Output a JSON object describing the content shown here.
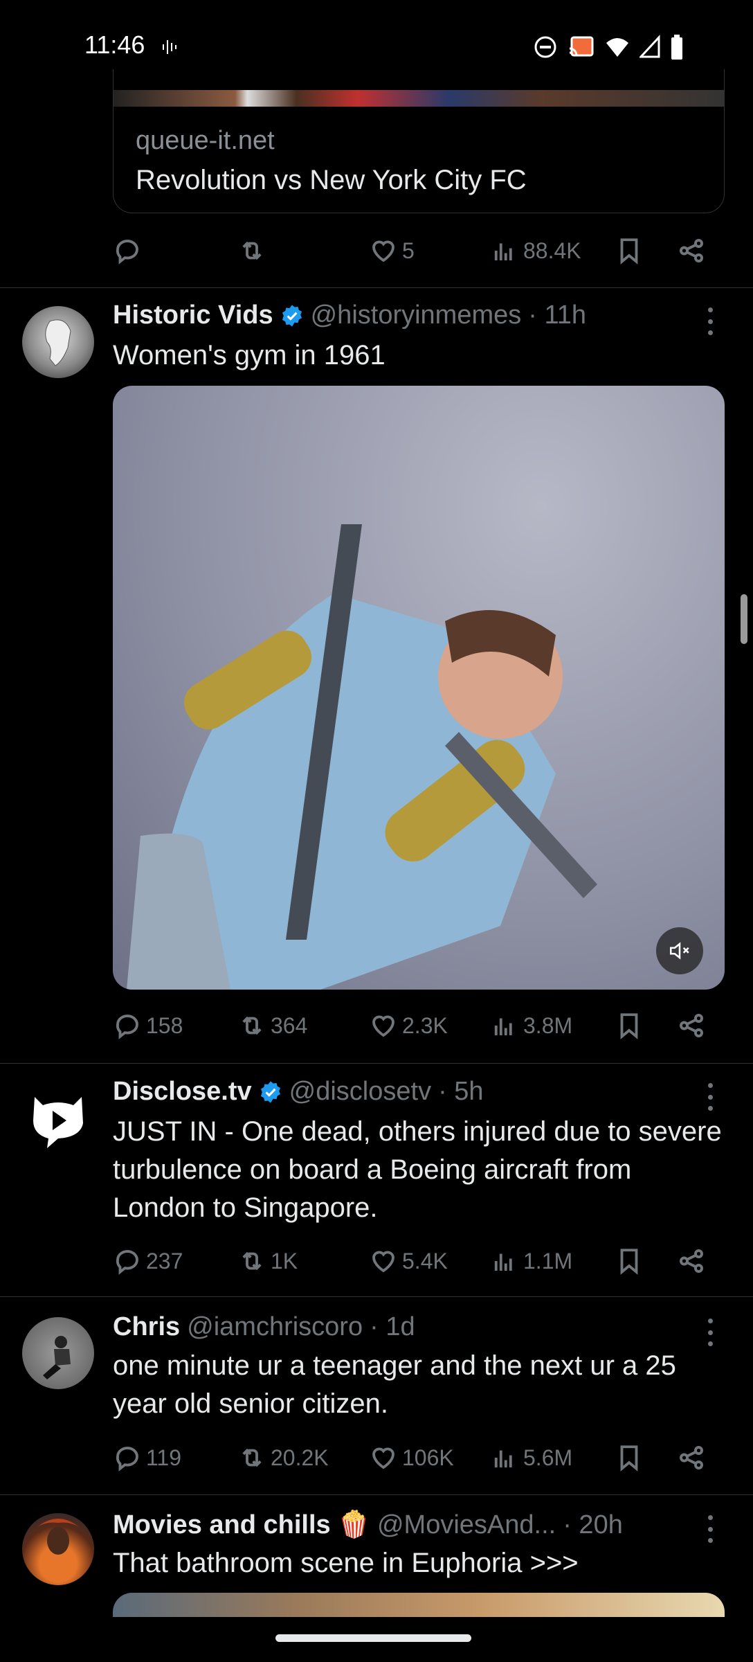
{
  "status_bar": {
    "time": "11:46"
  },
  "link_card": {
    "domain": "queue-it.net",
    "title": "Revolution vs New York City FC"
  },
  "tweets": [
    {
      "stats": {
        "replies": "",
        "reposts": "",
        "likes": "5",
        "views": "88.4K"
      }
    },
    {
      "name": "Historic Vids",
      "handle": "@historyinmemes",
      "time": "· 11h",
      "verified": true,
      "text": "Women's gym in 1961",
      "stats": {
        "replies": "158",
        "reposts": "364",
        "likes": "2.3K",
        "views": "3.8M"
      }
    },
    {
      "name": "Disclose.tv",
      "handle": "@disclosetv",
      "time": "· 5h",
      "verified": true,
      "text": "JUST IN - One dead, others injured due to severe turbulence on board a Boeing aircraft from London to Singapore.",
      "stats": {
        "replies": "237",
        "reposts": "1K",
        "likes": "5.4K",
        "views": "1.1M"
      }
    },
    {
      "name": "Chris",
      "handle": "@iamchriscoro",
      "time": "· 1d",
      "text": "one minute ur a teenager and the next ur a 25 year old senior citizen.",
      "stats": {
        "replies": "119",
        "reposts": "20.2K",
        "likes": "106K",
        "views": "5.6M"
      }
    },
    {
      "name": "Movies and chills",
      "emoji": "🍿",
      "handle": "@MoviesAnd...",
      "time": "· 20h",
      "text": "That bathroom scene in Euphoria >>>"
    }
  ],
  "colors": {
    "verified": "#1d9bf0",
    "muted": "#71767b",
    "divider": "#2f3336"
  }
}
